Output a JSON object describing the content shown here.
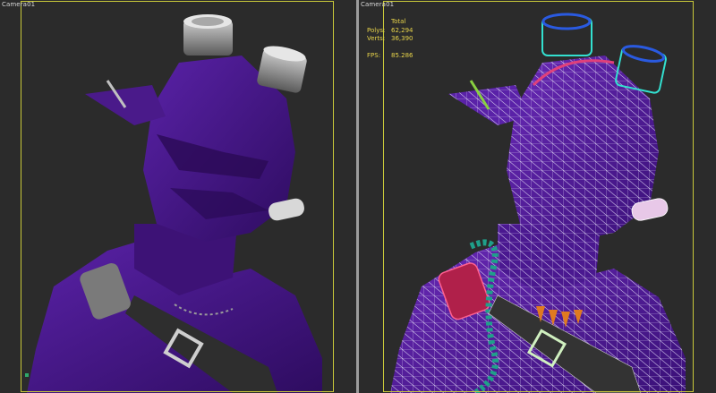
{
  "viewports": {
    "left": {
      "label": "Camera01",
      "mode": "shaded"
    },
    "right": {
      "label": "Camera01",
      "mode": "wireframe-on-shaded"
    }
  },
  "stats": {
    "title": "Total",
    "polys_label": "Polys:",
    "polys_value": "62,294",
    "verts_label": "Verts:",
    "verts_value": "36,390",
    "fps_label": "FPS:",
    "fps_value": "85.286"
  },
  "colors": {
    "background": "#2b2b2b",
    "model": "#4a1a8a",
    "safe_frame": "#c9c93a",
    "stats_text": "#e8d44a",
    "wire": "#ffffff",
    "accent_cyan": "#33e0d0",
    "accent_teal": "#1fa08a",
    "accent_pink": "#e0407a",
    "accent_orange": "#e07a20"
  }
}
